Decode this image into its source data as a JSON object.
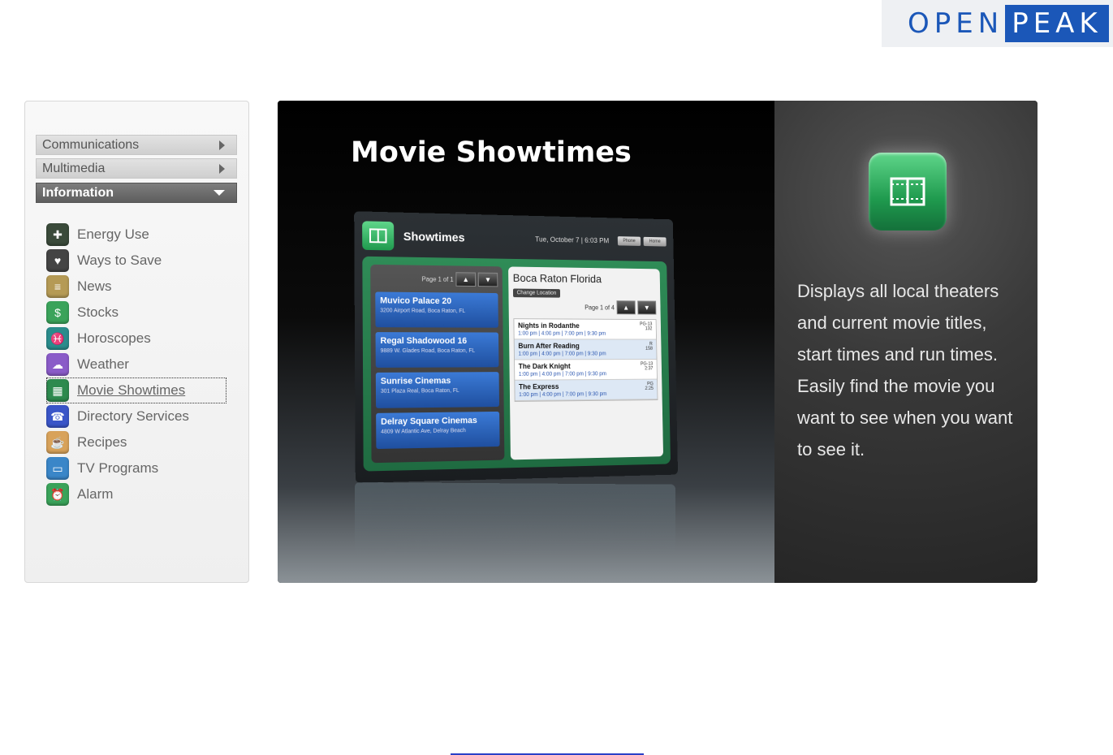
{
  "logo": {
    "part1": "OPEN",
    "part2": "PEAK"
  },
  "sidebar": {
    "categories": [
      {
        "label": "Communications",
        "state": "collapsed"
      },
      {
        "label": "Multimedia",
        "state": "collapsed"
      },
      {
        "label": "Information",
        "state": "expanded"
      }
    ],
    "items": [
      {
        "label": "Energy Use",
        "icon": "energy-icon",
        "color": "#3a4a3a",
        "glyph": "✚"
      },
      {
        "label": "Ways to Save",
        "icon": "save-icon",
        "color": "#444444",
        "glyph": "♥"
      },
      {
        "label": "News",
        "icon": "rss-icon",
        "color": "#b59a55",
        "glyph": "≡"
      },
      {
        "label": "Stocks",
        "icon": "stocks-icon",
        "color": "#3aa35a",
        "glyph": "$"
      },
      {
        "label": "Horoscopes",
        "icon": "horoscope-icon",
        "color": "#2a8c8c",
        "glyph": "♓"
      },
      {
        "label": "Weather",
        "icon": "weather-icon",
        "color": "#8a5bc8",
        "glyph": "☁"
      },
      {
        "label": "Movie Showtimes",
        "icon": "film-icon",
        "color": "#2d8a4e",
        "glyph": "▦"
      },
      {
        "label": "Directory Services",
        "icon": "directory-icon",
        "color": "#3a55c8",
        "glyph": "☎"
      },
      {
        "label": "Recipes",
        "icon": "recipes-icon",
        "color": "#d8a25a",
        "glyph": "☕"
      },
      {
        "label": "TV Programs",
        "icon": "tv-icon",
        "color": "#3a86c8",
        "glyph": "▭"
      },
      {
        "label": "Alarm",
        "icon": "alarm-icon",
        "color": "#3aa35a",
        "glyph": "⏰"
      }
    ],
    "selected_index": 6
  },
  "banner": {
    "title": "Movie Showtimes",
    "description": "Displays all local theaters and current movie titles, start times and run times. Easily find the movie you want to see when you want to see it."
  },
  "device": {
    "app_title": "Showtimes",
    "date": "Tue, October 7",
    "time": "6:03 PM",
    "btn1": "Phone",
    "btn2": "Home",
    "theaters_pager": "Page 1 of 1",
    "theaters": [
      {
        "name": "Muvico Palace 20",
        "address": "3200 Airport Road, Boca Raton, FL"
      },
      {
        "name": "Regal Shadowood 16",
        "address": "9889 W. Glades Road, Boca Raton, FL"
      },
      {
        "name": "Sunrise Cinemas",
        "address": "301 Plaza Real, Boca Raton, FL"
      },
      {
        "name": "Delray Square Cinemas",
        "address": "4809 W Atlantic Ave, Delray Beach"
      }
    ],
    "location": "Boca Raton Florida",
    "change_location": "Change Location",
    "movies_pager": "Page 1 of 4",
    "movies": [
      {
        "name": "Nights in Rodanthe",
        "times": "1:00 pm | 4:00 pm | 7:00 pm | 9:30 pm",
        "rating": "PG-13",
        "runtime": "132"
      },
      {
        "name": "Burn After Reading",
        "times": "1:00 pm | 4:00 pm | 7:00 pm | 9:30 pm",
        "rating": "R",
        "runtime": "158"
      },
      {
        "name": "The Dark Knight",
        "times": "1:00 pm | 4:00 pm | 7:00 pm | 9:30 pm",
        "rating": "PG-13",
        "runtime": "2:37"
      },
      {
        "name": "The Express",
        "times": "1:00 pm | 4:00 pm | 7:00 pm | 9:30 pm",
        "rating": "PG",
        "runtime": "2:25"
      }
    ]
  },
  "colors": {
    "brand_blue": "#1b57b8",
    "accent_green": "#2d8a4e",
    "link_blue": "#2a40c8"
  }
}
